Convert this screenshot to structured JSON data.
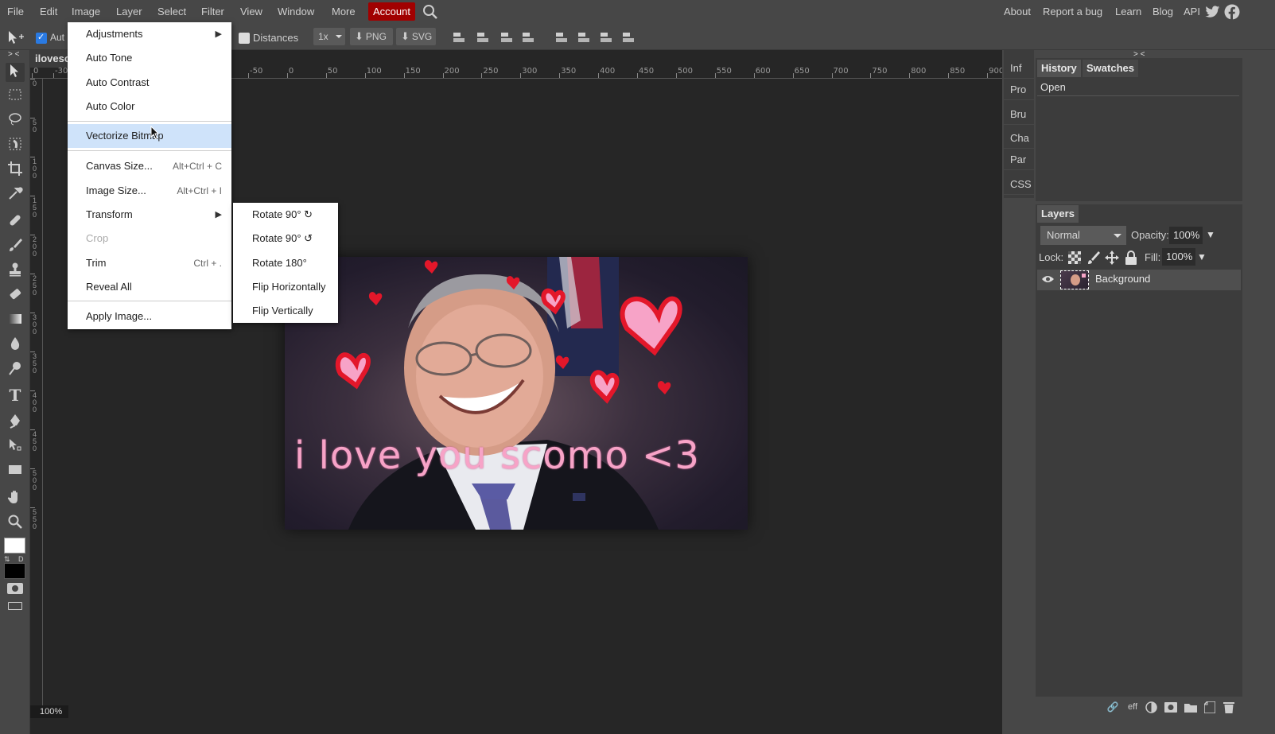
{
  "menubar": {
    "items": [
      {
        "label": "File"
      },
      {
        "label": "Edit"
      },
      {
        "label": "Image"
      },
      {
        "label": "Layer"
      },
      {
        "label": "Select"
      },
      {
        "label": "Filter"
      },
      {
        "label": "View"
      },
      {
        "label": "Window"
      },
      {
        "label": "More"
      },
      {
        "label": "Account"
      }
    ],
    "right_links": [
      {
        "label": "About"
      },
      {
        "label": "Report a bug"
      },
      {
        "label": "Learn"
      },
      {
        "label": "Blog"
      },
      {
        "label": "API"
      }
    ],
    "account_color": "#a10000"
  },
  "options_bar": {
    "auto_select_label": "Aut",
    "distances_label": "Distances",
    "scale_value": "1x",
    "png_label": "PNG",
    "svg_label": "SVG"
  },
  "document": {
    "tab_title": "ilovesc",
    "zoom": "100%",
    "canvas_text": "i love you scomo <3"
  },
  "ruler": {
    "h_labels": [
      "0",
      "-30",
      "-50",
      "0",
      "50",
      "100",
      "150",
      "200",
      "250",
      "300",
      "350",
      "400",
      "450",
      "500",
      "550",
      "600",
      "650",
      "700",
      "750",
      "800",
      "850",
      "900"
    ],
    "v_labels": [
      "0",
      "50",
      "100",
      "150",
      "200",
      "250",
      "300",
      "350",
      "400",
      "450",
      "500",
      "550"
    ]
  },
  "image_menu": {
    "items": [
      {
        "label": "Adjustments",
        "submenu": true
      },
      {
        "label": "Auto Tone"
      },
      {
        "label": "Auto Contrast"
      },
      {
        "label": "Auto Color"
      },
      {
        "label": "Vectorize Bitmap",
        "highlighted": true
      },
      {
        "label": "Canvas Size...",
        "shortcut": "Alt+Ctrl + C"
      },
      {
        "label": "Image Size...",
        "shortcut": "Alt+Ctrl + I"
      },
      {
        "label": "Transform",
        "submenu": true
      },
      {
        "label": "Crop",
        "disabled": true
      },
      {
        "label": "Trim",
        "shortcut": "Ctrl + ."
      },
      {
        "label": "Reveal All"
      },
      {
        "label": "Apply Image..."
      }
    ]
  },
  "transform_menu": {
    "items": [
      {
        "label": "Rotate 90° ↻"
      },
      {
        "label": "Rotate 90° ↺"
      },
      {
        "label": "Rotate 180°"
      },
      {
        "label": "Flip Horizontally"
      },
      {
        "label": "Flip Vertically"
      }
    ]
  },
  "side_tabs": [
    {
      "label": "Inf"
    },
    {
      "label": "Pro"
    },
    {
      "label": "Bru"
    },
    {
      "label": "Cha"
    },
    {
      "label": "Par"
    },
    {
      "label": "CSS"
    }
  ],
  "history_panel": {
    "tabs": [
      {
        "label": "History"
      },
      {
        "label": "Swatches"
      }
    ],
    "entries": [
      {
        "label": "Open"
      }
    ]
  },
  "layers_panel": {
    "title": "Layers",
    "blend_mode": "Normal",
    "opacity_label": "Opacity:",
    "opacity_value": "100%",
    "lock_label": "Lock:",
    "fill_label": "Fill:",
    "fill_value": "100%",
    "layers": [
      {
        "name": "Background"
      }
    ],
    "bottom_fx_label": "eff"
  },
  "collapse_glyphs": {
    "left": "> <",
    "mid": "< >",
    "right": "> <"
  }
}
